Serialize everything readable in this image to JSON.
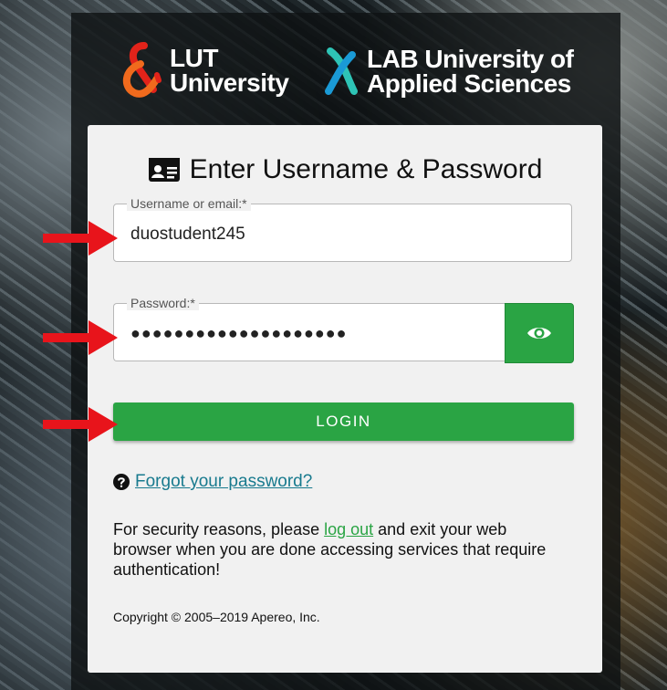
{
  "logos": {
    "lut_line1": "LUT",
    "lut_line2": "University",
    "lab_line1": "LAB University of",
    "lab_line2": "Applied Sciences"
  },
  "login": {
    "title": "Enter Username & Password",
    "username_label": "Username or email:*",
    "username_value": "duostudent245",
    "password_label": "Password:*",
    "password_value": "●●●●●●●●●●●●●●●●●●●●",
    "login_button": "LOGIN",
    "forgot_link": "Forgot your password?",
    "notice_before": "For security reasons, please ",
    "notice_link": "log out",
    "notice_after": " and exit your web browser when you are done accessing services that require authentication!",
    "copyright": "Copyright © 2005–2019 Apereo, Inc."
  },
  "colors": {
    "accent_green": "#2aa444",
    "link_teal": "#187a8e",
    "arrow_red": "#e8141b"
  },
  "icons": [
    "id-card-icon",
    "eye-icon",
    "question-circle-icon",
    "red-arrow-icon"
  ]
}
